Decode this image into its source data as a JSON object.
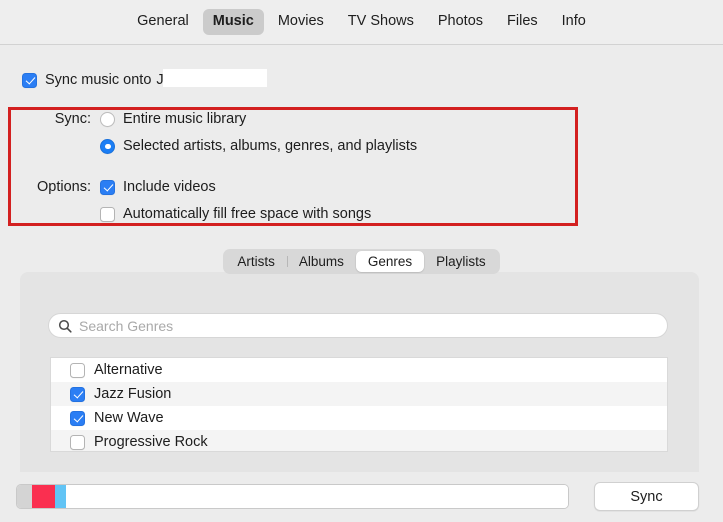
{
  "tabs": [
    {
      "label": "General",
      "selected": false
    },
    {
      "label": "Music",
      "selected": true
    },
    {
      "label": "Movies",
      "selected": false
    },
    {
      "label": "TV Shows",
      "selected": false
    },
    {
      "label": "Photos",
      "selected": false
    },
    {
      "label": "Files",
      "selected": false
    },
    {
      "label": "Info",
      "selected": false
    }
  ],
  "sync_section": {
    "enable_checkbox_label": "Sync music onto",
    "enable_checked": true,
    "device_name": "J",
    "device_name_redacted": true,
    "sync_label": "Sync:",
    "options": [
      {
        "label": "Entire music library",
        "selected": false
      },
      {
        "label": "Selected artists, albums, genres, and playlists",
        "selected": true
      }
    ],
    "highlight_color": "#d32020"
  },
  "options_section": {
    "label": "Options:",
    "items": [
      {
        "label": "Include videos",
        "checked": true
      },
      {
        "label": "Automatically fill free space with songs",
        "checked": false
      }
    ]
  },
  "browser": {
    "segments": [
      {
        "label": "Artists",
        "selected": false
      },
      {
        "label": "Albums",
        "selected": false
      },
      {
        "label": "Genres",
        "selected": true
      },
      {
        "label": "Playlists",
        "selected": false
      }
    ],
    "search": {
      "placeholder": "Search Genres",
      "value": "",
      "icon": "search-icon"
    },
    "list": [
      {
        "label": "Alternative",
        "checked": false
      },
      {
        "label": "Jazz Fusion",
        "checked": true
      },
      {
        "label": "New Wave",
        "checked": true
      },
      {
        "label": "Progressive Rock",
        "checked": false
      }
    ]
  },
  "bottom_bar": {
    "capacity_segments": [
      {
        "name": "other",
        "color": "#d4d4d4",
        "percent": 2.7
      },
      {
        "name": "audio",
        "color": "#fa2f50",
        "percent": 4.2
      },
      {
        "name": "video",
        "color": "#62c4f5",
        "percent": 2.0
      },
      {
        "name": "free",
        "color": "#ffffff",
        "percent": 91.1
      }
    ],
    "sync_button_label": "Sync"
  }
}
